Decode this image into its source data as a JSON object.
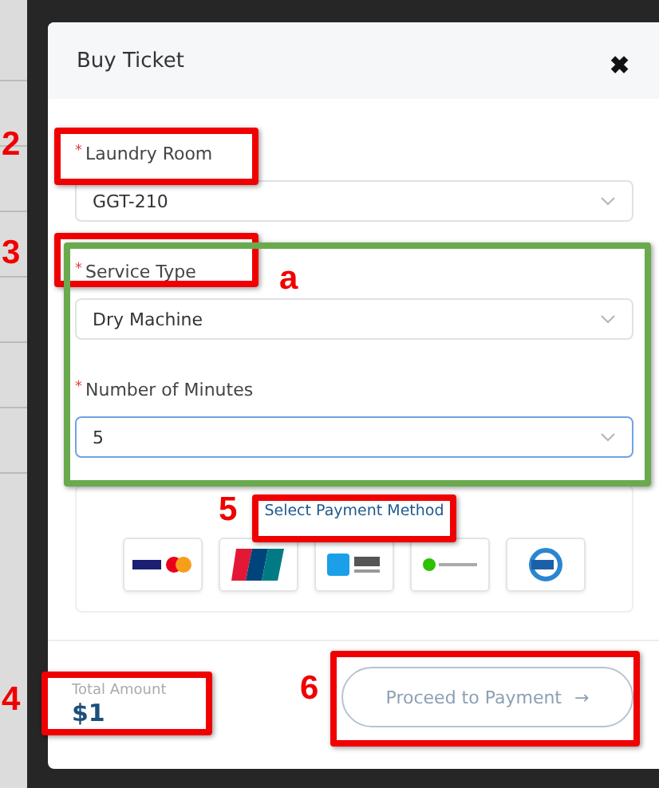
{
  "modal": {
    "title": "Buy Ticket",
    "close": "✖"
  },
  "fields": [
    {
      "marker": "*",
      "label": "Laundry Room",
      "value": "GGT-210",
      "focused": false
    },
    {
      "marker": "*",
      "label": "Service Type",
      "value": "Dry Machine",
      "focused": false
    },
    {
      "marker": "*",
      "label": "Number of Minutes",
      "value": "5",
      "focused": true
    }
  ],
  "payment": {
    "title": "Select Payment Method",
    "methods": [
      {
        "kind": "visa"
      },
      {
        "kind": "unionpay"
      },
      {
        "kind": "alipay"
      },
      {
        "kind": "wechat"
      },
      {
        "kind": "fps"
      }
    ]
  },
  "footer": {
    "total_label": "Total Amount",
    "total": "$1",
    "button": "Proceed to Payment",
    "button_icon": "→"
  },
  "annotations": [
    {
      "kind": "red",
      "label": "2"
    },
    {
      "kind": "red",
      "label": "3"
    },
    {
      "kind": "green",
      "label": "a"
    },
    {
      "kind": "red",
      "label": "5"
    },
    {
      "kind": "red",
      "label": "4"
    },
    {
      "kind": "red",
      "label": "6"
    }
  ]
}
